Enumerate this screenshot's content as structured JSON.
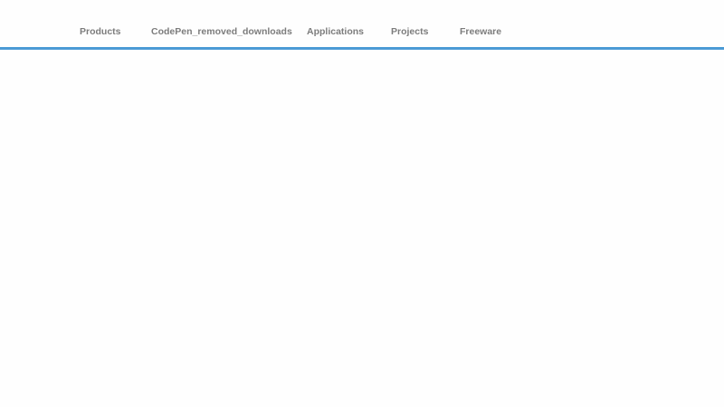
{
  "nav": {
    "items": [
      {
        "label": "Products"
      },
      {
        "label": "CodePen_removed_downloads"
      },
      {
        "label": "Applications"
      },
      {
        "label": "Projects"
      },
      {
        "label": "Freeware"
      }
    ]
  },
  "colors": {
    "accent": "#4b9ad5",
    "nav_text": "#7c7c7c",
    "background": "#fefefe"
  }
}
